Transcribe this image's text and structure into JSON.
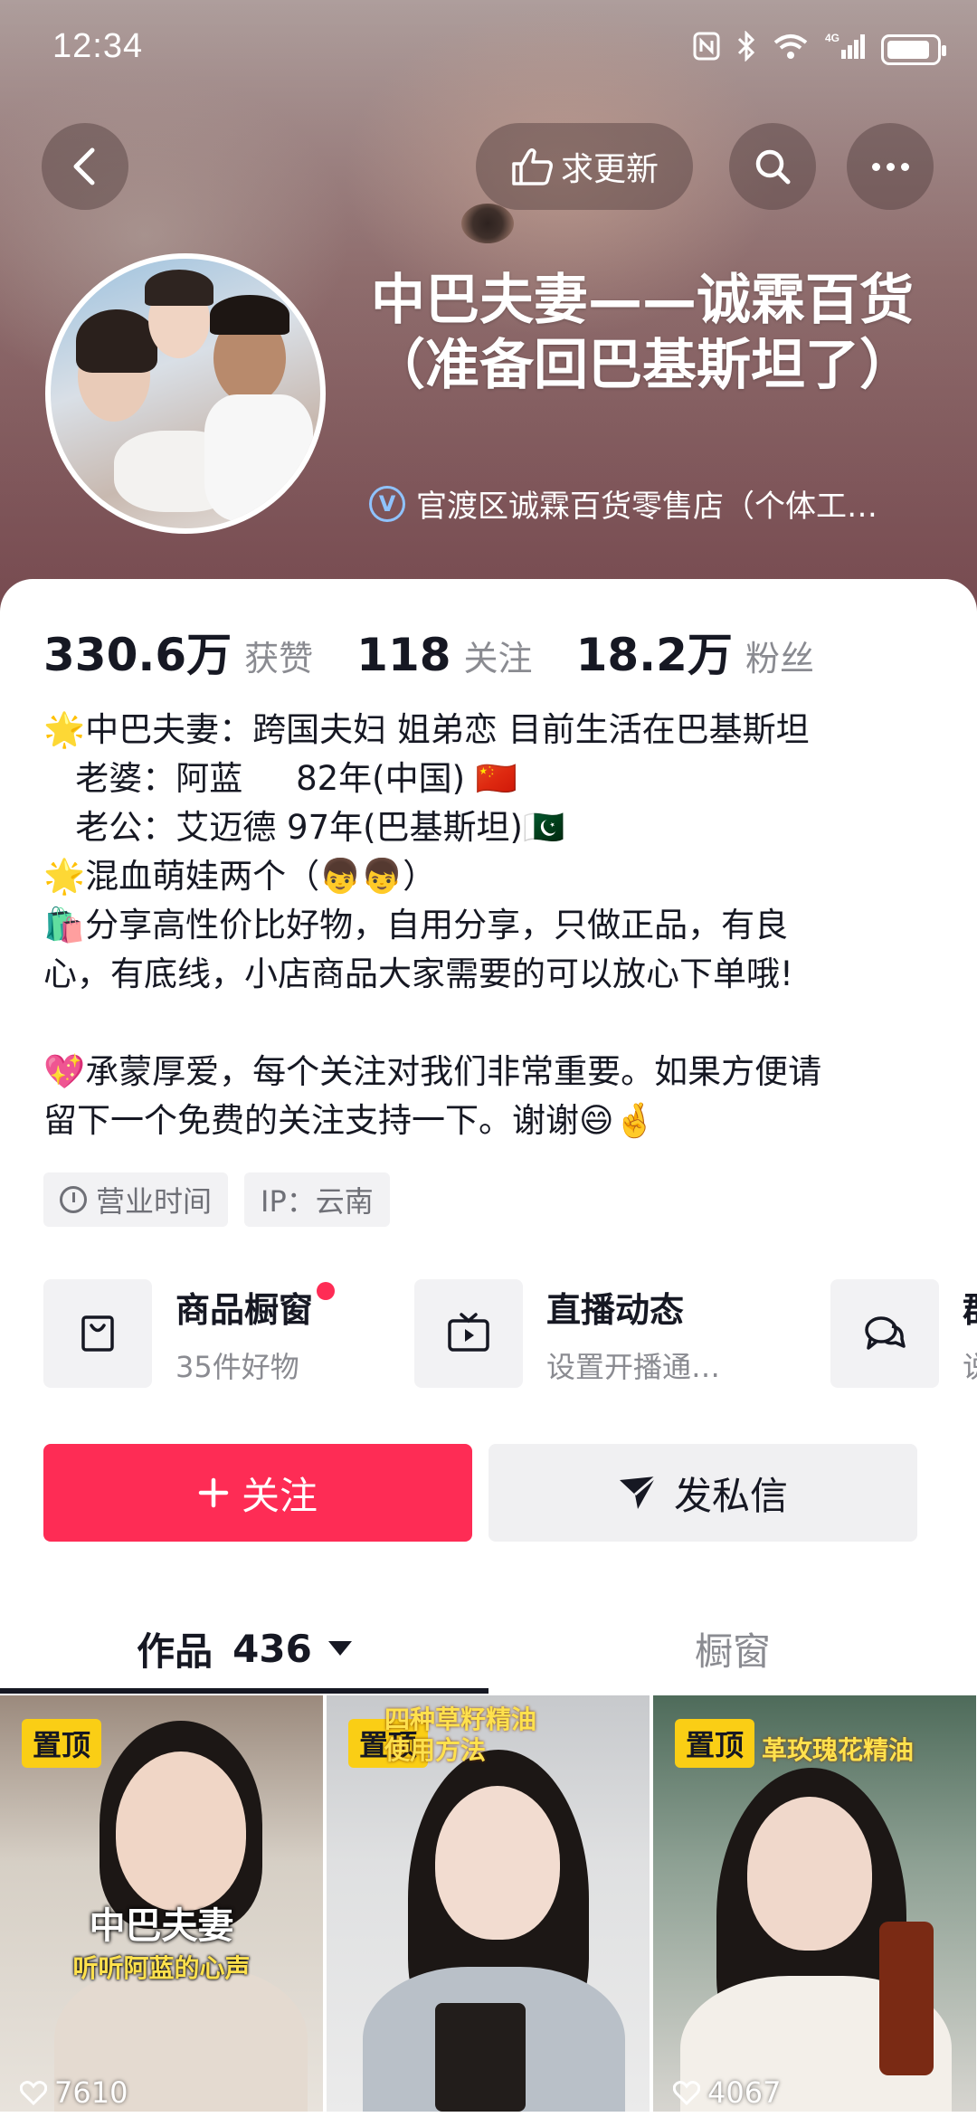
{
  "status_bar": {
    "time": "12:34",
    "network": "4G"
  },
  "nav": {
    "update_label": "求更新"
  },
  "profile": {
    "name": "中巴夫妻——诚霖百货（准备回巴基斯坦了）",
    "company": "官渡区诚霖百货零售店（个体工…",
    "verified_mark": "V"
  },
  "stats": [
    {
      "value": "330.6万",
      "label": "获赞"
    },
    {
      "value": "118",
      "label": "关注"
    },
    {
      "value": "18.2万",
      "label": "粉丝"
    }
  ],
  "bio": {
    "lines": [
      "🌟中巴夫妻：跨国夫妇 姐弟恋 目前生活在巴基斯坦",
      "   老婆：阿蓝     82年(中国) 🇨🇳",
      "   老公：艾迈德 97年(巴基斯坦)🇵🇰",
      "🌟混血萌娃两个（👦👦）",
      "🛍️分享高性价比好物，自用分享，只做正品，有良",
      "心，有底线，小店商品大家需要的可以放心下单哦!",
      "",
      "💖承蒙厚爱，每个关注对我们非常重要。如果方便请",
      "留下一个免费的关注支持一下。谢谢😄🤞"
    ]
  },
  "tags": [
    {
      "label": "营业时间",
      "icon": "clock-icon"
    },
    {
      "label": "IP：云南"
    }
  ],
  "features": [
    {
      "title": "商品橱窗",
      "subtitle": "35件好物",
      "icon": "shopping-bag-icon",
      "has_dot": true
    },
    {
      "title": "直播动态",
      "subtitle": "设置开播通…",
      "icon": "tv-icon"
    },
    {
      "title": "群",
      "subtitle": "说",
      "icon": "chat-icon"
    }
  ],
  "actions": {
    "follow_label": "关注",
    "message_label": "发私信"
  },
  "tabs": {
    "works_label": "作品",
    "works_count": "436",
    "shop_label": "橱窗"
  },
  "videos": [
    {
      "pin": "置顶",
      "caption_main": "中巴夫妻",
      "caption_sub": "听听阿蓝的心声",
      "likes": "7610"
    },
    {
      "pin": "置顶",
      "caption_top": "四种草籽精油\n使用方法",
      "likes": ""
    },
    {
      "pin": "置顶",
      "caption_top": "革玫瑰花精油",
      "likes": "4067"
    }
  ],
  "colors": {
    "accent": "#fe2c55",
    "pin": "#face15"
  }
}
